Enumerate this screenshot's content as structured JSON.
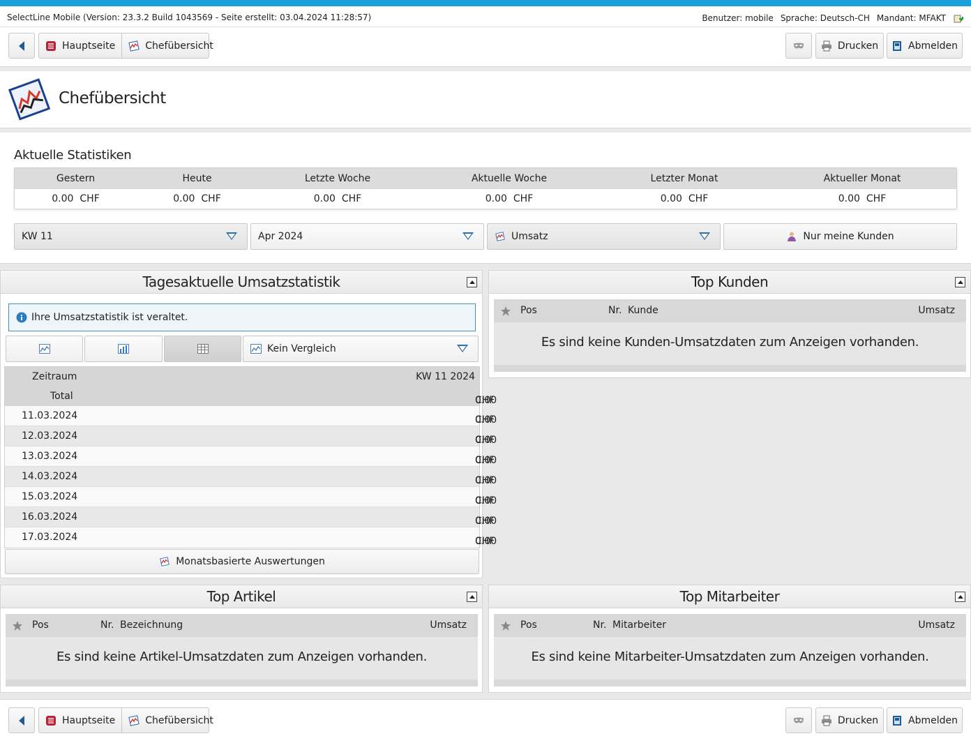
{
  "infobar": {
    "version": "SelectLine Mobile (Version: 23.3.2 Build 1043569 - Seite erstellt: 03.04.2024 11:28:57)",
    "user": "Benutzer: mobile",
    "language": "Sprache: Deutsch-CH",
    "client": "Mandant: MFAKT"
  },
  "nav": {
    "home": "Hauptseite",
    "current": "Chefübersicht",
    "print": "Drucken",
    "logout": "Abmelden"
  },
  "page": {
    "title": "Chefübersicht"
  },
  "stats": {
    "title": "Aktuelle Statistiken",
    "columns": [
      {
        "label": "Gestern",
        "value": "0.00",
        "unit": "CHF"
      },
      {
        "label": "Heute",
        "value": "0.00",
        "unit": "CHF"
      },
      {
        "label": "Letzte Woche",
        "value": "0.00",
        "unit": "CHF"
      },
      {
        "label": "Aktuelle Woche",
        "value": "0.00",
        "unit": "CHF"
      },
      {
        "label": "Letzter Monat",
        "value": "0.00",
        "unit": "CHF"
      },
      {
        "label": "Aktueller Monat",
        "value": "0.00",
        "unit": "CHF"
      }
    ]
  },
  "filters": {
    "week": "KW 11",
    "month": "Apr 2024",
    "metric": "Umsatz",
    "my_customers": "Nur meine Kunden"
  },
  "umsatz": {
    "title": "Tagesaktuelle Umsatzstatistik",
    "alert": "Ihre Umsatzstatistik ist veraltet.",
    "compare": "Kein Vergleich",
    "head_left": "Zeitraum",
    "head_right": "KW 11 2024",
    "total_label": "Total",
    "total_value": "0.00",
    "unit": "CHF",
    "rows": [
      {
        "date": "11.03.2024",
        "value": "0.00"
      },
      {
        "date": "12.03.2024",
        "value": "0.00"
      },
      {
        "date": "13.03.2024",
        "value": "0.00"
      },
      {
        "date": "14.03.2024",
        "value": "0.00"
      },
      {
        "date": "15.03.2024",
        "value": "0.00"
      },
      {
        "date": "16.03.2024",
        "value": "0.00"
      },
      {
        "date": "17.03.2024",
        "value": "0.00"
      }
    ],
    "monthly": "Monatsbasierte Auswertungen"
  },
  "top_kunden": {
    "title": "Top Kunden",
    "pos": "Pos",
    "nr": "Nr.",
    "name": "Kunde",
    "umsatz": "Umsatz",
    "empty": "Es sind keine Kunden-Umsatzdaten zum Anzeigen vorhanden."
  },
  "top_artikel": {
    "title": "Top Artikel",
    "pos": "Pos",
    "nr": "Nr.",
    "name": "Bezeichnung",
    "umsatz": "Umsatz",
    "empty": "Es sind keine Artikel-Umsatzdaten zum Anzeigen vorhanden."
  },
  "top_mitarbeiter": {
    "title": "Top Mitarbeiter",
    "pos": "Pos",
    "nr": "Nr.",
    "name": "Mitarbeiter",
    "umsatz": "Umsatz",
    "empty": "Es sind keine Mitarbeiter-Umsatzdaten zum Anzeigen vorhanden."
  },
  "colors": {
    "accent": "#1a9fd8",
    "alert_border": "#3d8fc6",
    "arrow": "#2b6fa8"
  }
}
